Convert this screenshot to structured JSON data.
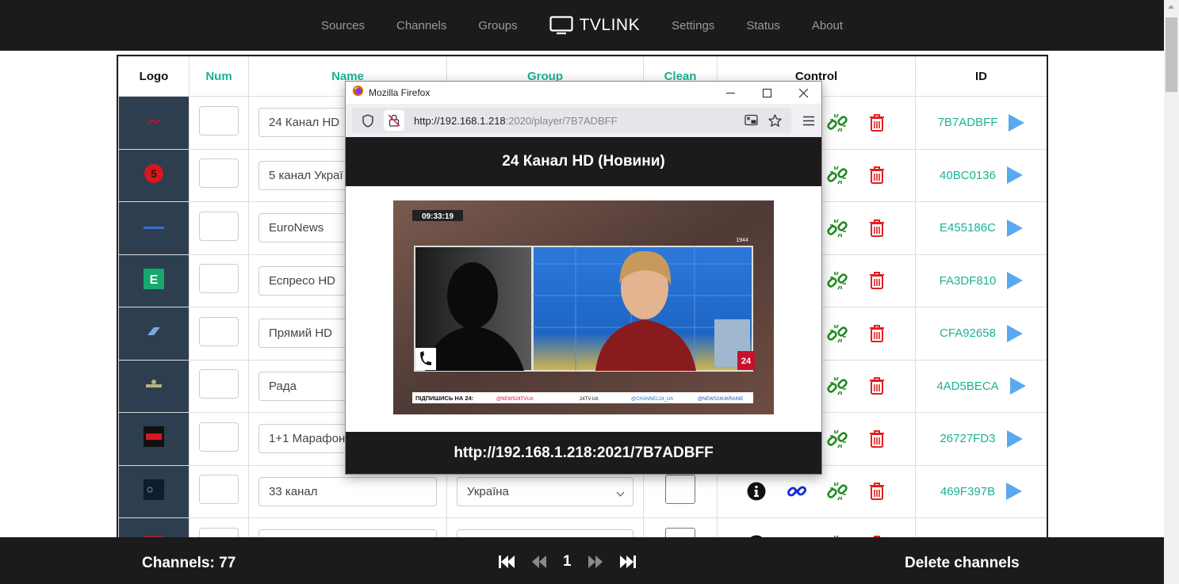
{
  "nav": {
    "items_left": [
      "Sources",
      "Channels",
      "Groups"
    ],
    "brand": "TVLINK",
    "items_right": [
      "Settings",
      "Status",
      "About"
    ]
  },
  "table": {
    "headers": [
      "Logo",
      "Num",
      "Name",
      "Group",
      "Clean",
      "Control",
      "ID"
    ],
    "rows": [
      {
        "name": "24 Канал HD",
        "group": "",
        "id": "7B7ADBFF"
      },
      {
        "name": "5 канал Украї",
        "group": "",
        "id": "40BC0136"
      },
      {
        "name": "EuroNews",
        "group": "",
        "id": "E455186C"
      },
      {
        "name": "Еспресо HD",
        "group": "",
        "id": "FA3DF810"
      },
      {
        "name": "Прямий HD",
        "group": "",
        "id": "CFA92658"
      },
      {
        "name": "Рада",
        "group": "",
        "id": "4AD5BECA"
      },
      {
        "name": "1+1 Марафон",
        "group": "",
        "id": "26727FD3"
      },
      {
        "name": "33 канал",
        "group": "Україна",
        "id": "469F397B"
      },
      {
        "name": "",
        "group": "",
        "id": ""
      }
    ]
  },
  "footer": {
    "channels_label": "Channels: 77",
    "page": "1",
    "delete_label": "Delete channels"
  },
  "popup": {
    "window_title": "Mozilla Firefox",
    "url_host": "http://192.168.1.218",
    "url_rest": ":2020/player/7B7ADBFF",
    "header": "24 Канал HD (Новини)",
    "stream_url": "http://192.168.1.218:2021/7B7ADBFF",
    "video": {
      "clock": "09:33:19",
      "ticker": "ПІДПИШИСЬ НА 24:",
      "ticker_items": [
        "@NEWS24TVUA",
        "24TV.UA",
        "@CHANNEL24_UA",
        "@NEWS24UKRAINE"
      ],
      "corner_badge": "1944",
      "logo": "24"
    }
  },
  "colors": {
    "accent": "#1ab394",
    "delete": "#e02020",
    "link": "#1a2fd6",
    "reset": "#1f8a1f",
    "play": "#5aa9f0"
  }
}
